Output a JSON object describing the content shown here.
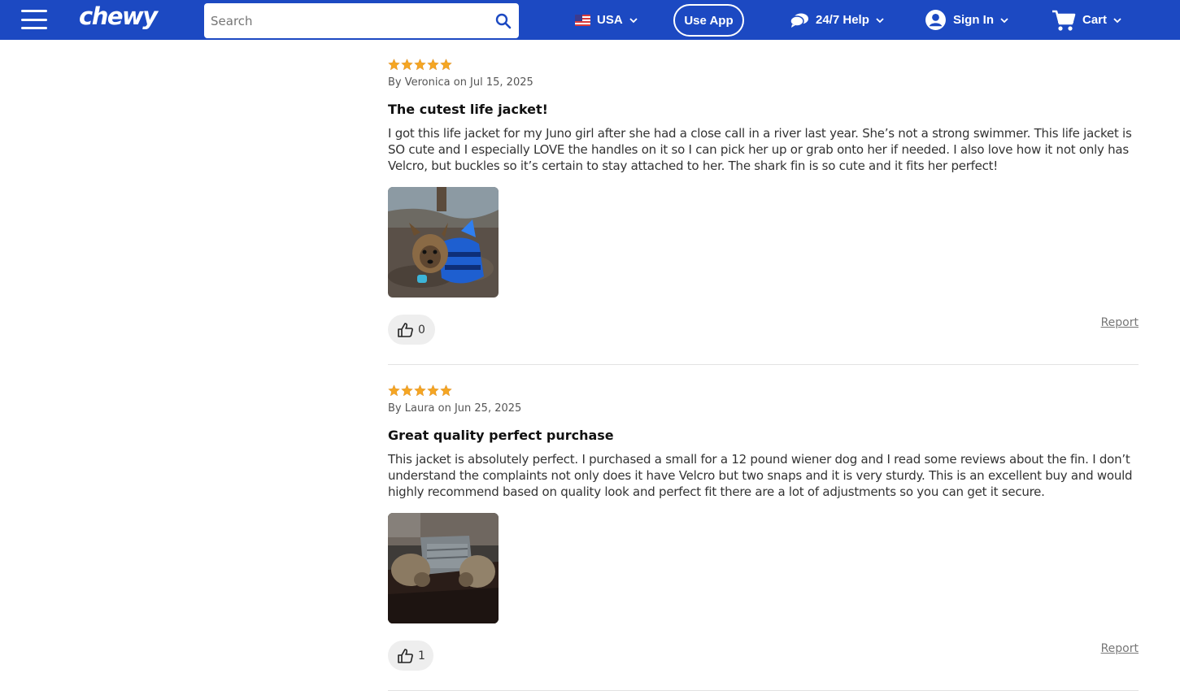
{
  "header": {
    "logo": "chewy",
    "search_placeholder": "Search",
    "country": "USA",
    "use_app": "Use App",
    "help": "24/7 Help",
    "sign_in": "Sign In",
    "cart": "Cart"
  },
  "colors": {
    "header_bg": "#1c49c2",
    "star": "#f5a623"
  },
  "reviews": [
    {
      "rating": 5,
      "byline": "By Veronica on Jul 15, 2025",
      "title": "The cutest life jacket!",
      "body": "I got this life jacket for my Juno girl after she had a close call in a river last year. She’s not a strong swimmer. This life jacket is SO cute and I especially LOVE the handles on it so I can pick her up or grab onto her if needed. I also love how it not only has Velcro, but buckles so it’s certain to stay attached to her. The shark fin is so cute and it fits her perfect!",
      "helpful_count": "0",
      "report": "Report"
    },
    {
      "rating": 5,
      "byline": "By Laura on Jun 25, 2025",
      "title": "Great quality perfect purchase",
      "body": "This jacket is absolutely perfect. I purchased a small for a 12 pound wiener dog and I read some reviews about the fin. I don’t understand the complaints not only does it have Velcro but two snaps and it is very sturdy. This is an excellent buy and would highly recommend based on quality look and perfect fit there are a lot of adjustments so you can get it secure.",
      "helpful_count": "1",
      "report": "Report"
    }
  ]
}
